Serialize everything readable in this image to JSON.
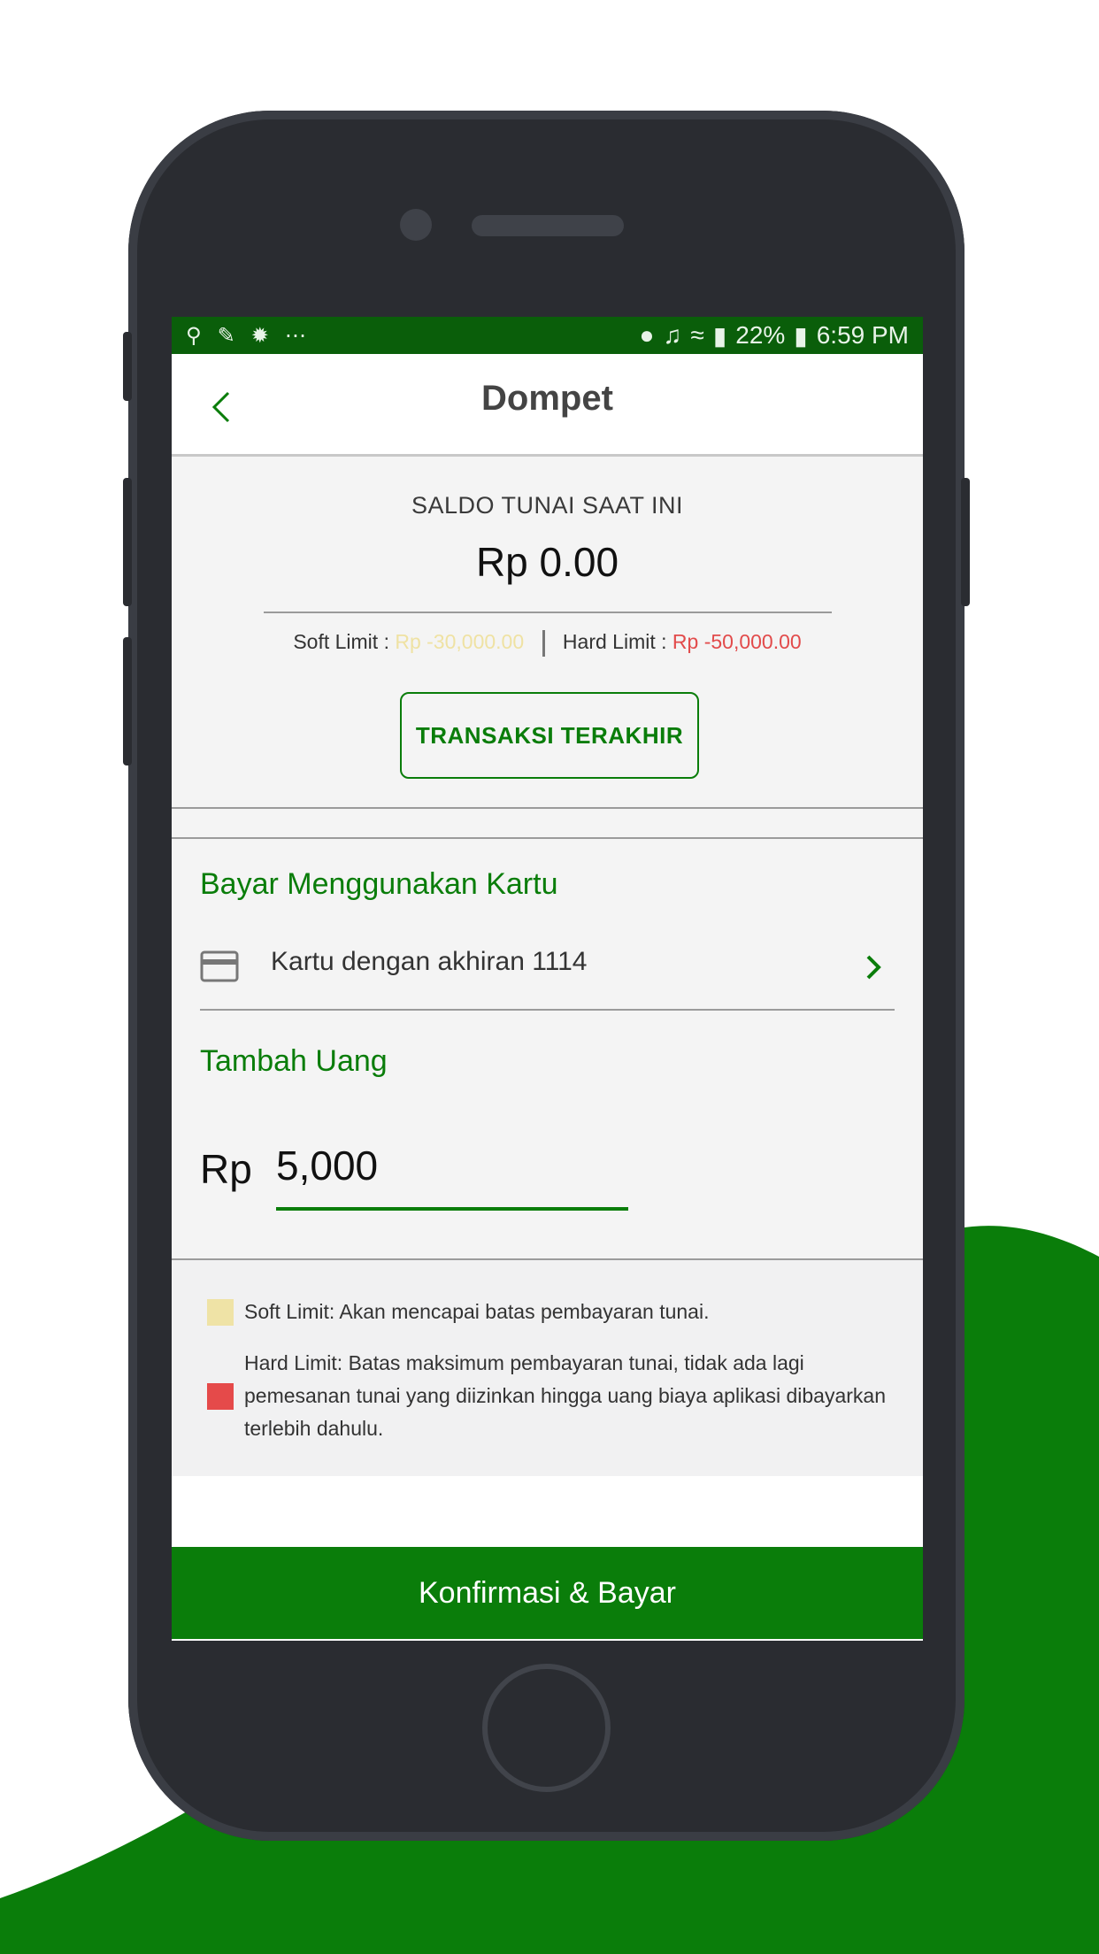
{
  "status_bar": {
    "left_icons": [
      "leaf-icon",
      "app-icon",
      "settings-icon",
      "more-icon"
    ],
    "battery_percent": "22%",
    "time": "6:59 PM"
  },
  "header": {
    "title": "Dompet"
  },
  "balance": {
    "label": "SALDO TUNAI SAAT INI",
    "value": "Rp 0.00",
    "soft_limit_label": "Soft Limit :",
    "soft_limit_value": "Rp -30,000.00",
    "hard_limit_label": "Hard Limit :",
    "hard_limit_value": "Rp -50,000.00",
    "recent_button": "TRANSAKSI TERAKHIR"
  },
  "pay_card": {
    "title": "Bayar Menggunakan Kartu",
    "card_text": "Kartu dengan akhiran 1114"
  },
  "top_up": {
    "title": "Tambah Uang",
    "currency": "Rp",
    "amount": "5,000"
  },
  "legend": {
    "soft_text": "Soft Limit: Akan mencapai batas pembayaran tunai.",
    "hard_text": "Hard Limit: Batas maksimum pembayaran tunai, tidak ada lagi pemesanan tunai yang diizinkan hingga uang biaya aplikasi dibayarkan terlebih dahulu."
  },
  "cta": {
    "label": "Konfirmasi & Bayar"
  },
  "colors": {
    "brand_green": "#0a7d0a",
    "status_green": "#0a5e0a",
    "soft_limit": "#efe3a6",
    "hard_limit": "#e54a4a",
    "phone_body": "#2a2c31"
  }
}
